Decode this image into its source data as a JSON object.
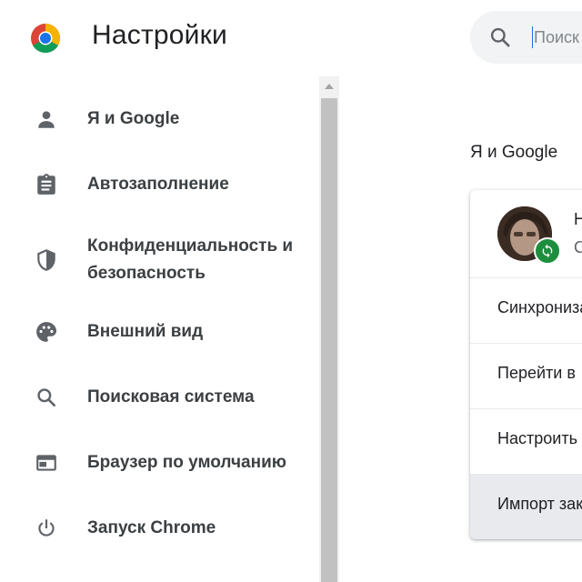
{
  "header": {
    "title": "Настройки",
    "search_placeholder": "Поиск"
  },
  "sidebar": {
    "items": [
      {
        "label": "Я и Google",
        "icon": "person-icon"
      },
      {
        "label": "Автозаполнение",
        "icon": "clipboard-icon"
      },
      {
        "label": "Конфиденциальность и безопасность",
        "icon": "shield-icon"
      },
      {
        "label": "Внешний вид",
        "icon": "palette-icon"
      },
      {
        "label": "Поисковая система",
        "icon": "search-icon"
      },
      {
        "label": "Браузер по умолчанию",
        "icon": "browser-window-icon"
      },
      {
        "label": "Запуск Chrome",
        "icon": "power-icon"
      }
    ]
  },
  "main": {
    "section_title": "Я и Google",
    "profile": {
      "name": "Н",
      "subtitle": "С"
    },
    "rows": [
      {
        "label": "Синхронизация сервисов Google"
      },
      {
        "label": "Перейти в"
      },
      {
        "label": "Настроить"
      },
      {
        "label": "Импорт закладок"
      }
    ]
  },
  "colors": {
    "accent": "#1a73e8",
    "sync_badge": "#1e8e3e",
    "icon_gray": "#5f6368",
    "row_hover": "#e8eaed"
  }
}
